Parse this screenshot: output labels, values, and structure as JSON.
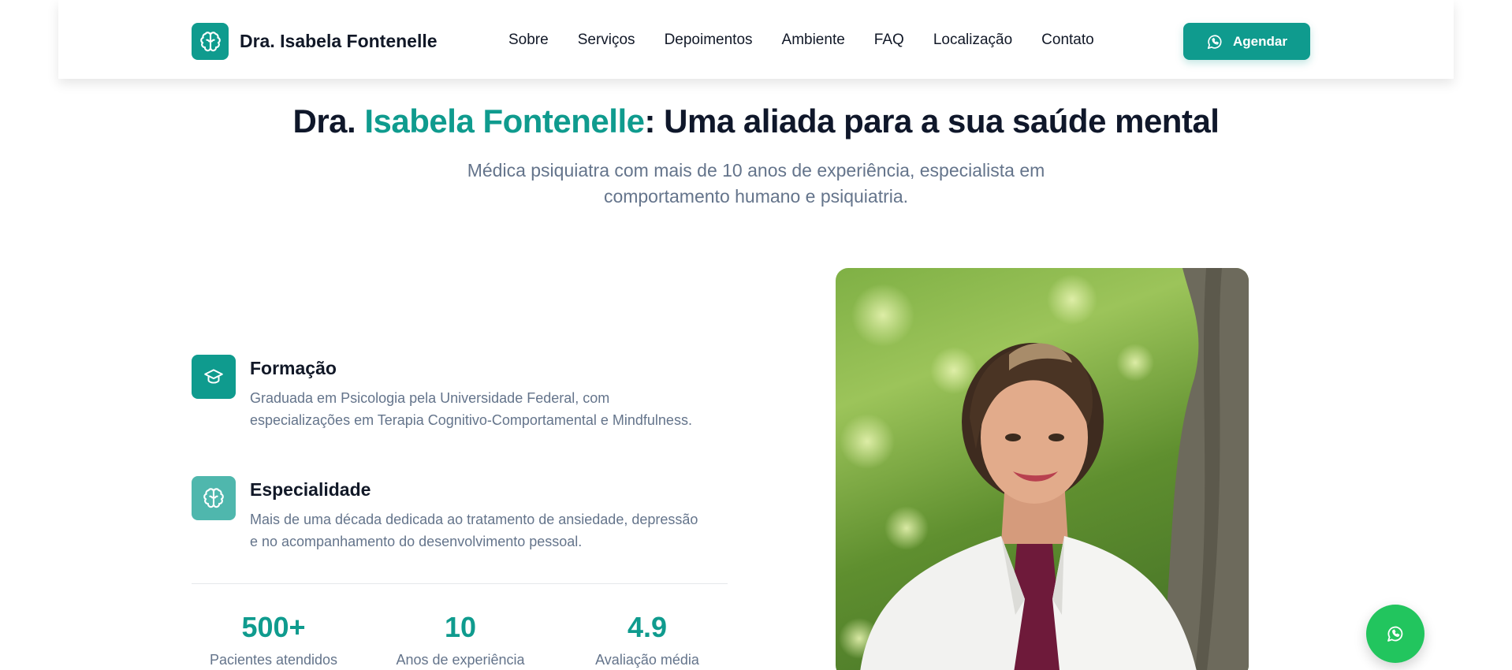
{
  "brand": {
    "name": "Dra. Isabela Fontenelle",
    "icon": "brain-icon"
  },
  "nav": {
    "items": [
      "Sobre",
      "Serviços",
      "Depoimentos",
      "Ambiente",
      "FAQ",
      "Localização",
      "Contato"
    ]
  },
  "cta": {
    "label": "Agendar",
    "icon": "whatsapp-icon"
  },
  "hero": {
    "title_prefix": "Dra. ",
    "title_accent": "Isabela Fontenelle",
    "title_suffix": ": Uma aliada para a sua saúde mental",
    "subtitle": "Médica psiquiatra com mais de 10 anos de experiência, especialista em comportamento humano e psiquiatria."
  },
  "features": [
    {
      "title": "Formação",
      "icon": "graduation-cap-icon",
      "desc": "Graduada em Psicologia pela Universidade Federal, com especializações em Terapia Cognitivo-Comportamental e Mindfulness."
    },
    {
      "title": "Especialidade",
      "icon": "brain-icon",
      "desc": "Mais de uma década dedicada ao tratamento de ansiedade, depressão e no acompanhamento do desenvolvimento pessoal."
    }
  ],
  "stats": [
    {
      "value": "500+",
      "label": "Pacientes atendidos"
    },
    {
      "value": "10",
      "label": "Anos de experiência"
    },
    {
      "value": "4.9",
      "label": "Avaliação média"
    }
  ],
  "colors": {
    "accent": "#0f9b8e",
    "accent_light": "#4fb7ad",
    "whatsapp": "#22c55e",
    "text_muted": "#64748b"
  }
}
